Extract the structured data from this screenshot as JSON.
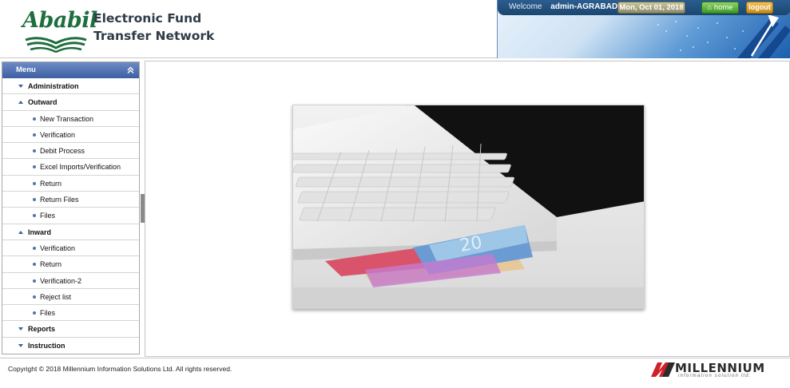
{
  "header": {
    "logo_text": "Ababil",
    "title_line1": "Electronic Fund",
    "title_line2": "Transfer Network",
    "welcome_label": "Welcome",
    "username": "admin-AGRABAD",
    "date": "Mon, Oct 01, 2018",
    "home_label": "home",
    "logout_label": "logout"
  },
  "sidebar": {
    "menu_title": "Menu",
    "items": [
      {
        "label": "Administration",
        "type": "group",
        "state": "collapsed"
      },
      {
        "label": "Outward",
        "type": "group",
        "state": "expanded"
      },
      {
        "label": "New Transaction",
        "type": "sub"
      },
      {
        "label": "Verification",
        "type": "sub"
      },
      {
        "label": "Debit Process",
        "type": "sub"
      },
      {
        "label": "Excel Imports/Verification",
        "type": "sub"
      },
      {
        "label": "Return",
        "type": "sub"
      },
      {
        "label": "Return Files",
        "type": "sub"
      },
      {
        "label": "Files",
        "type": "sub"
      },
      {
        "label": "Inward",
        "type": "group",
        "state": "expanded"
      },
      {
        "label": "Verification",
        "type": "sub"
      },
      {
        "label": "Return",
        "type": "sub"
      },
      {
        "label": "Verification-2",
        "type": "sub"
      },
      {
        "label": "Reject list",
        "type": "sub"
      },
      {
        "label": "Files",
        "type": "sub"
      },
      {
        "label": "Reports",
        "type": "group",
        "state": "collapsed"
      },
      {
        "label": "Instruction",
        "type": "group",
        "state": "collapsed"
      }
    ]
  },
  "footer": {
    "copyright": "Copyright © 2018 Millennium Information Solutions Ltd. All rights reserved.",
    "company_logo_name": "MILLENNIUM",
    "company_logo_tagline": "information solution ltd."
  },
  "colors": {
    "menu_header": "#3d5fa3",
    "brand_green": "#1e6e3e",
    "topbar": "#1b4670",
    "home_button": "#3f9a22",
    "logout_button": "#c98a16",
    "millennium_red": "#d0202a"
  },
  "icons": {
    "collapse_menu": "double-chevron-up-icon",
    "group_collapsed": "triangle-down-icon",
    "group_expanded": "triangle-up-icon",
    "sub_item": "bullet-dot-icon",
    "home": "house-icon"
  }
}
